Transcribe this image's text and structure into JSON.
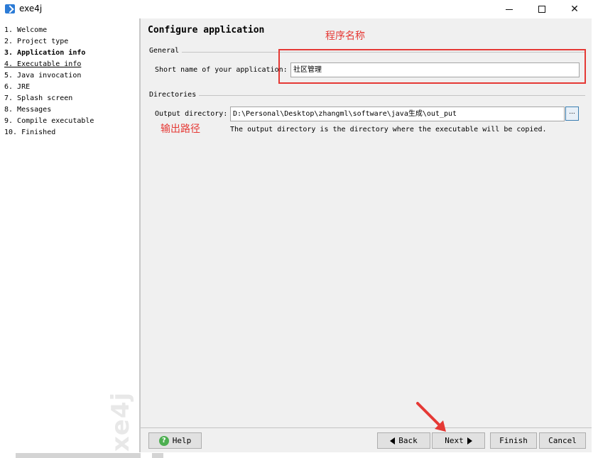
{
  "window": {
    "title": "exe4j",
    "minimize_label": "",
    "maximize_label": "",
    "close_label": "✕"
  },
  "sidebar": {
    "steps": [
      {
        "label": "1. Welcome",
        "state": "normal"
      },
      {
        "label": "2. Project type",
        "state": "normal"
      },
      {
        "label": "3. Application info",
        "state": "current"
      },
      {
        "label": "4. Executable info",
        "state": "visited"
      },
      {
        "label": "5. Java invocation",
        "state": "normal"
      },
      {
        "label": "6. JRE",
        "state": "normal"
      },
      {
        "label": "7. Splash screen",
        "state": "normal"
      },
      {
        "label": "8. Messages",
        "state": "normal"
      },
      {
        "label": "9. Compile executable",
        "state": "normal"
      },
      {
        "label": "10. Finished",
        "state": "normal"
      }
    ],
    "watermark": "exe4j"
  },
  "main": {
    "title": "Configure application",
    "general": {
      "section_label": "General",
      "short_name_label": "Short name of your application:",
      "short_name_value": "社区管理"
    },
    "directories": {
      "section_label": "Directories",
      "output_label": "Output directory:",
      "output_value": "D:\\Personal\\Desktop\\zhangml\\software\\java生成\\out_put",
      "browse_label": "...",
      "hint": "The output directory is the directory where the executable will be copied."
    }
  },
  "annotations": {
    "program_name": "程序名称",
    "output_path": "输出路径",
    "color": "#e53935"
  },
  "buttons": {
    "help": "Help",
    "back": "Back",
    "next": "Next",
    "finish": "Finish",
    "cancel": "Cancel"
  },
  "icons": {
    "app": "exe4j-app-icon",
    "help": "help-icon",
    "back": "arrow-left-icon",
    "next": "arrow-right-icon"
  }
}
